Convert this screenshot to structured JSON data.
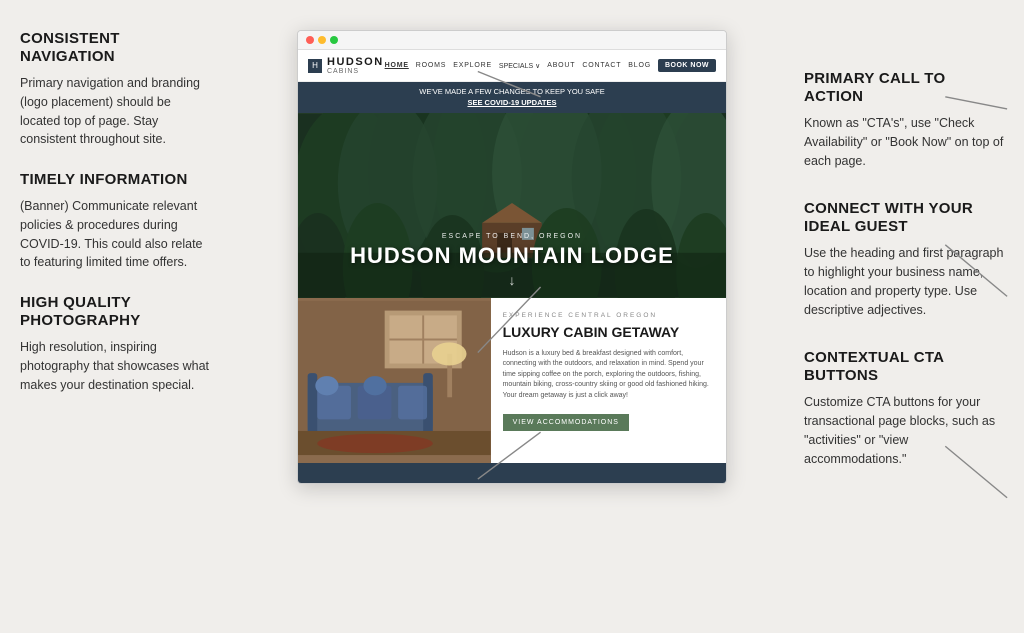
{
  "left": {
    "sections": [
      {
        "id": "consistent-nav",
        "title": "CONSISTENT NAVIGATION",
        "body": "Primary navigation and branding (logo placement) should be located top of page. Stay consistent throughout site."
      },
      {
        "id": "timely-info",
        "title": "TIMELY INFORMATION",
        "body": "(Banner) Communicate relevant policies & procedures during COVID-19. This could also relate to featuring limited time offers."
      },
      {
        "id": "high-quality",
        "title": "HIGH QUALITY PHOTOGRAPHY",
        "body": "High resolution, inspiring photography that showcases what makes your destination special."
      }
    ]
  },
  "right": {
    "sections": [
      {
        "id": "primary-cta",
        "title": "PRIMARY CALL TO ACTION",
        "body": "Known as \"CTA's\", use \"Check Availability\" or \"Book Now\" on top of each page."
      },
      {
        "id": "connect-guest",
        "title": "CONNECT WITH YOUR IDEAL GUEST",
        "body": "Use the heading and first paragraph to highlight your business name, location and property type. Use descriptive adjectives."
      },
      {
        "id": "contextual-cta",
        "title": "CONTEXTUAL CTA BUTTONS",
        "body": "Customize CTA buttons for your transactional page blocks, such as \"activities\" or \"view accommodations.\""
      }
    ]
  },
  "browser": {
    "site_header": {
      "logo": "HUDSON",
      "logo_sub": "CABINS",
      "nav_items": [
        "HOME",
        "ROOMS",
        "EXPLORE",
        "SPECIALS",
        "ABOUT",
        "CONTACT",
        "BLOG"
      ],
      "specials_dropdown": "∨",
      "book_now": "BOOK NOW"
    },
    "covid_banner": {
      "line1": "WE'VE MADE A FEW CHANGES TO KEEP YOU SAFE",
      "link": "SEE COVID-19 UPDATES"
    },
    "hero": {
      "subtitle": "ESCAPE TO BEND, OREGON",
      "title": "HUDSON MOUNTAIN LODGE",
      "arrow": "↓"
    },
    "cabin": {
      "label": "EXPERIENCE CENTRAL OREGON",
      "title": "LUXURY CABIN GETAWAY",
      "desc": "Hudson is a luxury bed & breakfast designed with comfort, connecting with the outdoors, and relaxation in mind. Spend your time sipping coffee on the porch, exploring the outdoors, fishing, mountain biking, cross-country skiing or good old fashioned hiking. Your dream getaway is just a click away!",
      "cta": "VIEW ACCOMMODATIONS"
    }
  }
}
